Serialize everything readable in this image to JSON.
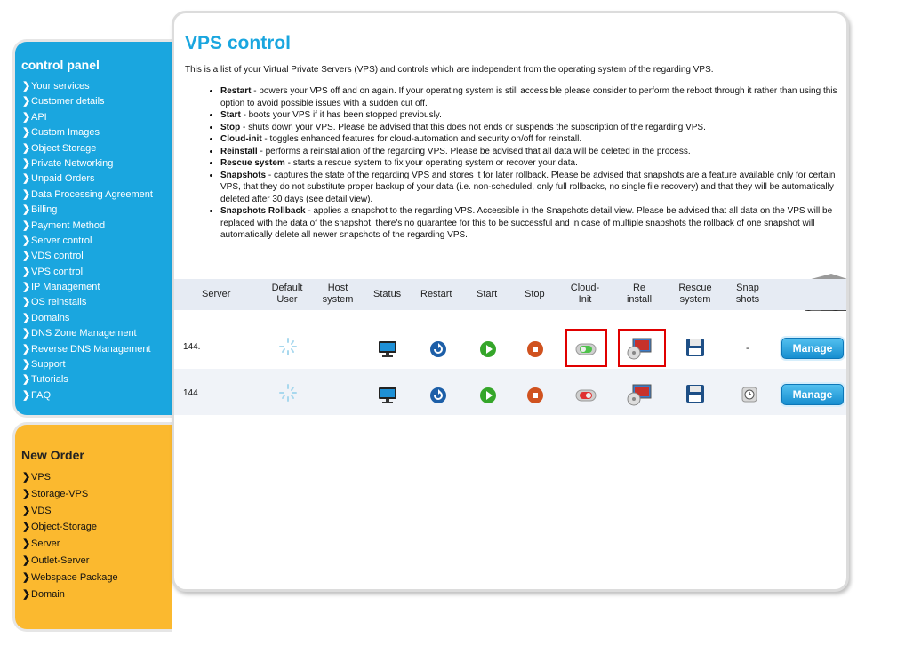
{
  "control_panel": {
    "title": "control panel",
    "items": [
      "Your services",
      "Customer details",
      "API",
      "Custom Images",
      "Object Storage",
      "Private Networking",
      "Unpaid Orders",
      "Data Processing Agreement",
      "Billing",
      "Payment Method",
      "Server control",
      "VDS control",
      "VPS control",
      "IP Management",
      "OS reinstalls",
      "Domains",
      "DNS Zone Management",
      "Reverse DNS Management",
      "Support",
      "Tutorials",
      "FAQ"
    ]
  },
  "new_order": {
    "title": "New Order",
    "items": [
      "VPS",
      "Storage-VPS",
      "VDS",
      "Object-Storage",
      "Server",
      "Outlet-Server",
      "Webspace Package",
      "Domain"
    ]
  },
  "main": {
    "title": "VPS control",
    "intro": "This is a list of your Virtual Private Servers (VPS) and controls which are independent from the operating system of the regarding VPS.",
    "bullets": [
      {
        "term": "Restart",
        "text": " - powers your VPS off and on again. If your operating system is still accessible please consider to perform the reboot through it rather than using this option to avoid possible issues with a sudden cut off."
      },
      {
        "term": "Start",
        "text": " - boots your VPS if it has been stopped previously."
      },
      {
        "term": "Stop",
        "text": " - shuts down your VPS. Please be advised that this does not ends or suspends the subscription of the regarding VPS."
      },
      {
        "term": "Cloud-init",
        "text": " - toggles enhanced features for cloud-automation and security on/off for reinstall."
      },
      {
        "term": "Reinstall",
        "text": " - performs a reinstallation of the regarding VPS. Please be advised that all data will be deleted in the process."
      },
      {
        "term": "Rescue system",
        "text": " - starts a rescue system to fix your operating system or recover your data."
      },
      {
        "term": "Snapshots",
        "text": " - captures the state of the regarding VPS and stores it for later rollback. Please be advised that snapshots are a feature available only for certain VPS, that they do not substitute proper backup of your data (i.e. non-scheduled, only full rollbacks, no single file recovery) and that they will be automatically deleted after 30 days (see detail view)."
      },
      {
        "term": "Snapshots Rollback",
        "text": " - applies a snapshot to the regarding VPS. Accessible in the Snapshots detail view. Please be advised that all data on the VPS will be replaced with the data of the snapshot, there's no guarantee for this to be successful and in case of multiple snapshots the rollback of one snapshot will automatically delete all newer snapshots of the regarding VPS."
      }
    ]
  },
  "table": {
    "headers": {
      "server": "Server",
      "default_user": [
        "Default",
        "User"
      ],
      "host_system": [
        "Host",
        "system"
      ],
      "status": "Status",
      "restart": "Restart",
      "start": "Start",
      "stop": "Stop",
      "cloud_init": [
        "Cloud-",
        "Init"
      ],
      "reinstall": [
        "Re",
        "install"
      ],
      "rescue": [
        "Rescue",
        "system"
      ],
      "snapshots": [
        "Snap",
        "shots"
      ]
    },
    "rows": [
      {
        "server": "144.",
        "cloud_init": "on",
        "snapshots": "-",
        "manage": "Manage"
      },
      {
        "server": "144",
        "cloud_init": "off",
        "snapshots": "",
        "manage": "Manage"
      }
    ]
  },
  "colors": {
    "accent_blue": "#1aa6df",
    "order_orange": "#fbb92f",
    "highlight_red": "#e00000"
  }
}
